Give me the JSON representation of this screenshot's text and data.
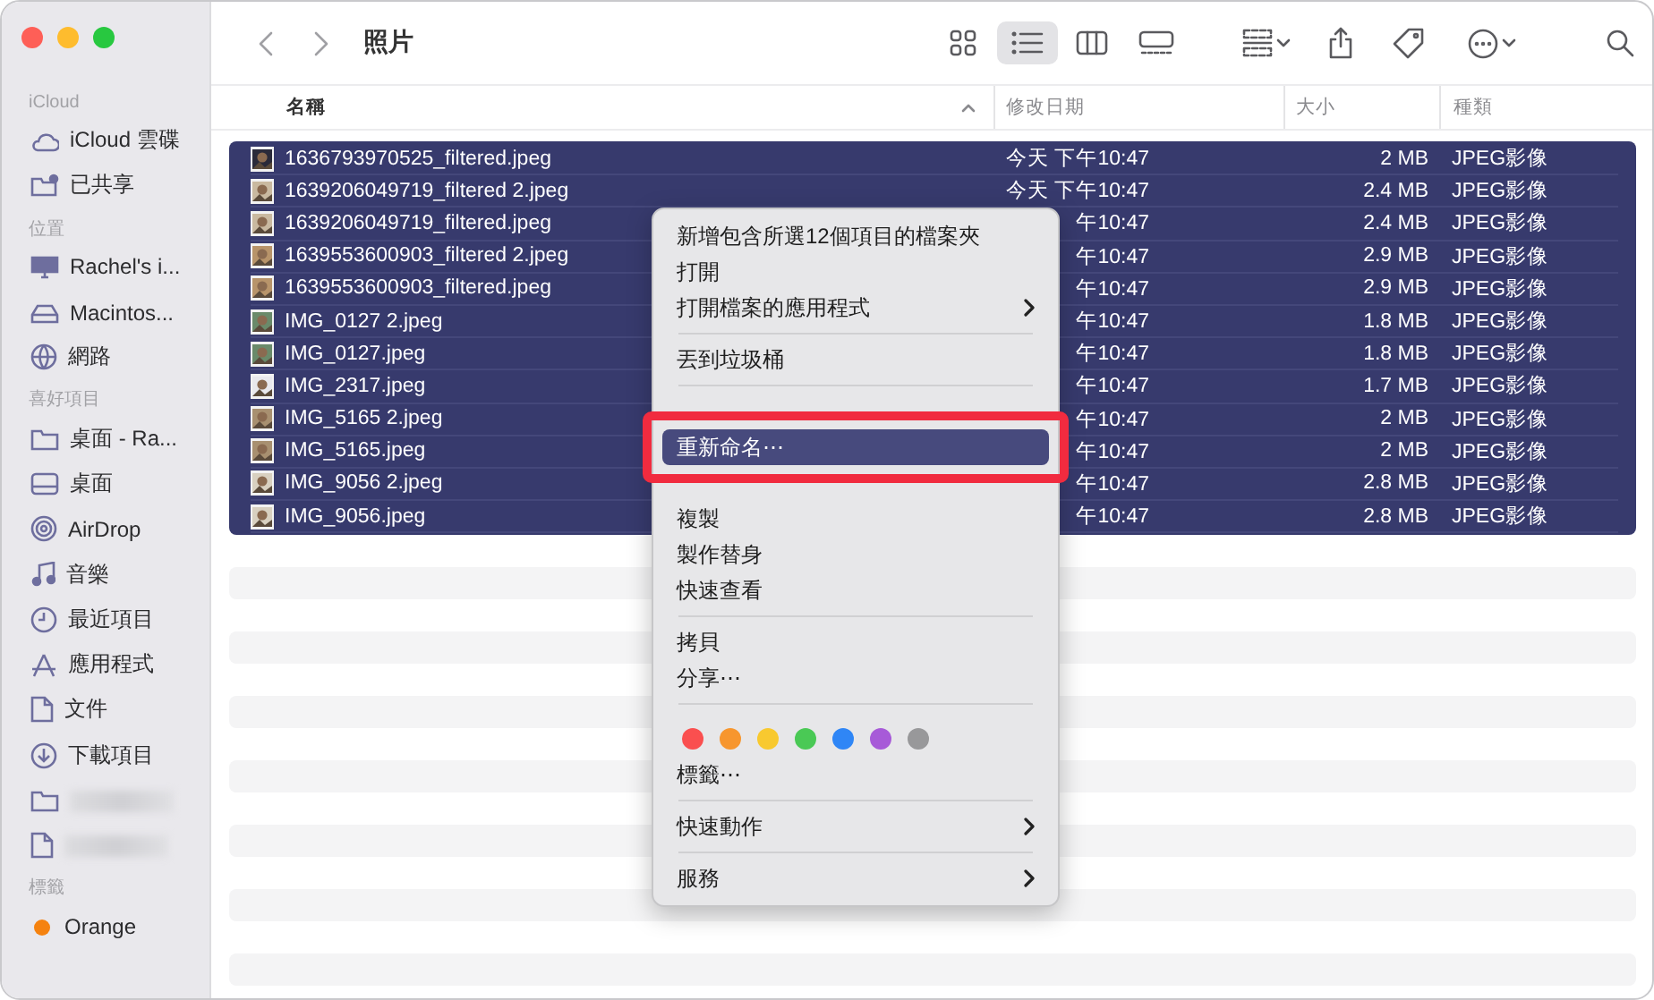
{
  "window": {
    "title": "照片"
  },
  "sidebar": {
    "sections": [
      {
        "heading": "iCloud",
        "items": [
          {
            "kind": "item",
            "label": "iCloud 雲碟"
          },
          {
            "kind": "item",
            "label": "已共享"
          }
        ]
      },
      {
        "heading": "位置",
        "items": [
          {
            "kind": "item",
            "label": "Rachel's i..."
          },
          {
            "kind": "item",
            "label": "Macintos..."
          },
          {
            "kind": "item",
            "label": "網路"
          }
        ]
      },
      {
        "heading": "喜好項目",
        "items": [
          {
            "kind": "item",
            "label": "桌面 - Ra..."
          },
          {
            "kind": "item",
            "label": "桌面"
          },
          {
            "kind": "item",
            "label": "AirDrop"
          },
          {
            "kind": "item",
            "label": "音樂"
          },
          {
            "kind": "item",
            "label": "最近項目"
          },
          {
            "kind": "item",
            "label": "應用程式"
          },
          {
            "kind": "item",
            "label": "文件"
          },
          {
            "kind": "item",
            "label": "下載項目"
          },
          {
            "kind": "redacted"
          },
          {
            "kind": "redacted"
          }
        ]
      },
      {
        "heading": "標籤",
        "items": [
          {
            "kind": "tag",
            "label": "Orange",
            "color": "#f5820f"
          }
        ]
      }
    ]
  },
  "toolbar": {
    "view_buttons": [
      {
        "selected": false
      },
      {
        "selected": true
      },
      {
        "selected": false
      },
      {
        "selected": false
      }
    ]
  },
  "table": {
    "columns": [
      "名稱",
      "修改日期",
      "大小",
      "種類"
    ],
    "rows": [
      {
        "name": "1636793970525_filtered.jpeg",
        "date": "今天 下午10:47",
        "size": "2 MB",
        "kind": "JPEG影像",
        "selected": true
      },
      {
        "name": "1639206049719_filtered 2.jpeg",
        "date": "今天 下午10:47",
        "size": "2.4 MB",
        "kind": "JPEG影像",
        "selected": true
      },
      {
        "name": "1639206049719_filtered.jpeg",
        "date": "午10:47",
        "size": "2.4 MB",
        "kind": "JPEG影像",
        "selected": true
      },
      {
        "name": "1639553600903_filtered 2.jpeg",
        "date": "午10:47",
        "size": "2.9 MB",
        "kind": "JPEG影像",
        "selected": true
      },
      {
        "name": "1639553600903_filtered.jpeg",
        "date": "午10:47",
        "size": "2.9 MB",
        "kind": "JPEG影像",
        "selected": true
      },
      {
        "name": "IMG_0127 2.jpeg",
        "date": "午10:47",
        "size": "1.8 MB",
        "kind": "JPEG影像",
        "selected": true
      },
      {
        "name": "IMG_0127.jpeg",
        "date": "午10:47",
        "size": "1.8 MB",
        "kind": "JPEG影像",
        "selected": true
      },
      {
        "name": "IMG_2317.jpeg",
        "date": "午10:47",
        "size": "1.7 MB",
        "kind": "JPEG影像",
        "selected": true
      },
      {
        "name": "IMG_5165 2.jpeg",
        "date": "午10:47",
        "size": "2 MB",
        "kind": "JPEG影像",
        "selected": true
      },
      {
        "name": "IMG_5165.jpeg",
        "date": "午10:47",
        "size": "2 MB",
        "kind": "JPEG影像",
        "selected": true
      },
      {
        "name": "IMG_9056 2.jpeg",
        "date": "午10:47",
        "size": "2.8 MB",
        "kind": "JPEG影像",
        "selected": true
      },
      {
        "name": "IMG_9056.jpeg",
        "date": "午10:47",
        "size": "2.8 MB",
        "kind": "JPEG影像",
        "selected": true
      }
    ]
  },
  "context_menu": {
    "items": [
      {
        "kind": "item",
        "label": "新增包含所選12個項目的檔案夾",
        "selected": false,
        "submenu": false
      },
      {
        "kind": "item",
        "label": "打開",
        "selected": false,
        "submenu": false
      },
      {
        "kind": "item",
        "label": "打開檔案的應用程式",
        "selected": false,
        "submenu": true
      },
      {
        "kind": "separator"
      },
      {
        "kind": "item",
        "label": "丟到垃圾桶",
        "selected": false,
        "submenu": false
      },
      {
        "kind": "separator"
      },
      {
        "kind": "item",
        "label": "重新命名⋯",
        "selected": true,
        "submenu": false
      },
      {
        "kind": "item",
        "label": "複製",
        "selected": false,
        "submenu": false
      },
      {
        "kind": "item",
        "label": "製作替身",
        "selected": false,
        "submenu": false
      },
      {
        "kind": "item",
        "label": "快速查看",
        "selected": false,
        "submenu": false
      },
      {
        "kind": "separator"
      },
      {
        "kind": "item",
        "label": "拷貝",
        "selected": false,
        "submenu": false
      },
      {
        "kind": "item",
        "label": "分享⋯",
        "selected": false,
        "submenu": false
      },
      {
        "kind": "separator"
      },
      {
        "kind": "colors",
        "colors": [
          {
            "color": "#fa4f4f"
          },
          {
            "color": "#f7962e"
          },
          {
            "color": "#f8c92f"
          },
          {
            "color": "#4ac955"
          },
          {
            "color": "#2f86f6"
          },
          {
            "color": "#a75ad8"
          },
          {
            "color": "#98989a"
          }
        ]
      },
      {
        "kind": "item",
        "label": "標籤⋯",
        "selected": false,
        "submenu": false
      },
      {
        "kind": "separator"
      },
      {
        "kind": "item",
        "label": "快速動作",
        "selected": false,
        "submenu": true
      },
      {
        "kind": "separator"
      },
      {
        "kind": "item",
        "label": "服務",
        "selected": false,
        "submenu": true
      }
    ]
  }
}
